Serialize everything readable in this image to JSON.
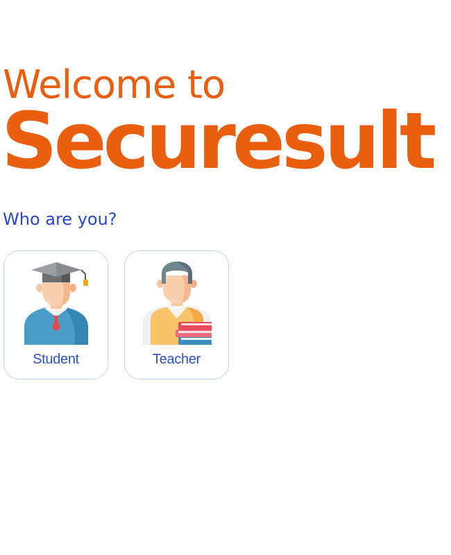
{
  "header": {
    "welcome_text": "Welcome to",
    "brand_name": "Securesult"
  },
  "prompt": {
    "question": "Who are you?"
  },
  "roles": [
    {
      "label": "Student",
      "icon": "student-graduate-icon"
    },
    {
      "label": "Teacher",
      "icon": "teacher-books-icon"
    }
  ],
  "colors": {
    "brand": "#e95e0f",
    "question_text": "#2747c9",
    "card_label": "#2a53c8",
    "card_border": "#bcd7f5"
  }
}
